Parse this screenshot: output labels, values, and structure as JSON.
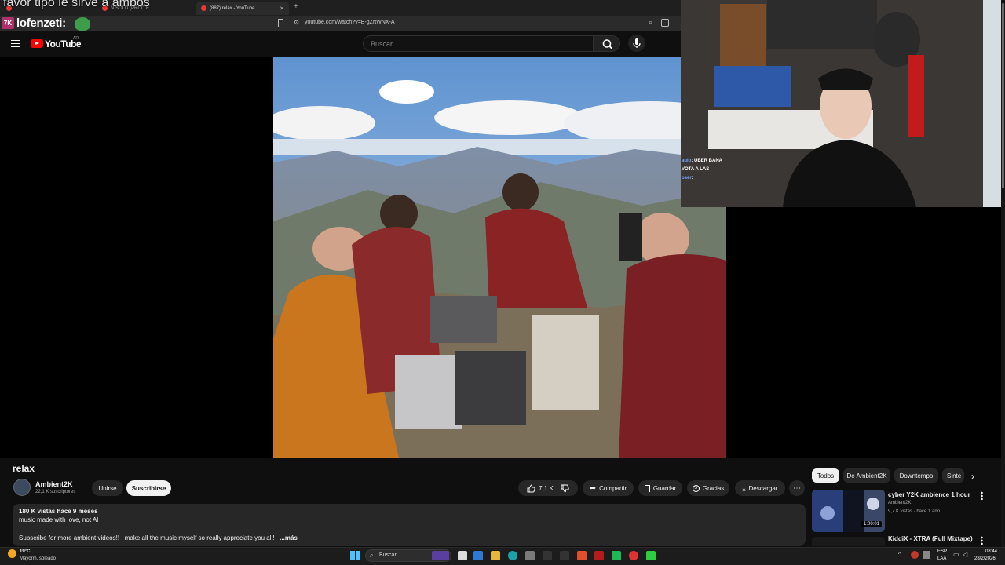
{
  "overlay_caption": "favor tipo le sirve a ambos",
  "stream_brand": {
    "logo": "7K",
    "name": "lofenzeti:"
  },
  "browser": {
    "tabs": [
      {
        "label": "",
        "active": false
      },
      {
        "label": "N SOLD (PROD.E",
        "active": false
      },
      {
        "label": "(887) relax - YouTube",
        "active": true
      }
    ],
    "url": "youtube.com/watch?v=B-gZrtWNX-A"
  },
  "youtube": {
    "logo_text": "YouTube",
    "region": "AR",
    "search_placeholder": "Buscar"
  },
  "stream_chat": {
    "lines": [
      {
        "user": "aulo",
        "text": ": UBER BANA"
      },
      {
        "user": "",
        "text": "VOTA A LAS"
      },
      {
        "user": "oser",
        "text": ":"
      }
    ]
  },
  "video": {
    "title": "relax",
    "channel": {
      "name": "Ambient2K",
      "subscribers": "22,1 K suscriptores"
    },
    "join_label": "Unirse",
    "subscribe_label": "Suscribirse",
    "likes": "7,1 K",
    "actions": {
      "share": "Compartir",
      "save": "Guardar",
      "thanks": "Gracias",
      "download": "Descargar"
    },
    "description": {
      "stats": "180 K vistas  hace 9 meses",
      "line1": "music made with love, not AI",
      "line2": "Subscribe for more ambient videos!! I make all the music myself so really appreciate you all!",
      "more": "...más"
    }
  },
  "rail": {
    "chips": [
      "Todos",
      "De Ambient2K",
      "Downtempo",
      "Sinte"
    ],
    "recommendations": [
      {
        "title": "cyber Y2K ambience 1 hour",
        "channel": "Ambient2K",
        "meta": "9,7 K vistas · hace 1 año",
        "duration": "1:00:01"
      },
      {
        "title": "KiddiX - XTRA (Full Mixtape)"
      }
    ]
  },
  "taskbar": {
    "weather_temp": "19°C",
    "weather_desc": "Mayorm. soleado",
    "search_label": "Buscar",
    "lang_line1": "ESP",
    "lang_line2": "LAA",
    "time": "08:44",
    "date": "28/2/2026"
  },
  "colors": {
    "accent_red": "#ff0000",
    "bg": "#0f0f0f",
    "chip_bg": "#272727"
  }
}
